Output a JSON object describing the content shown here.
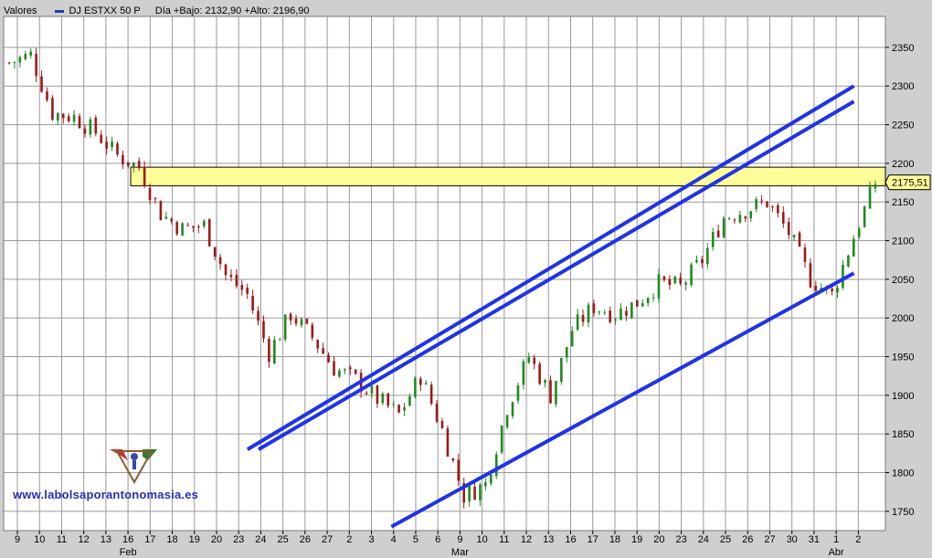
{
  "header": {
    "panel_label": "Valores",
    "series_label": "DJ ESTXX 50 P",
    "stats": "Día +Bajo: 2132,90 +Alto: 2196,90"
  },
  "price_label": "2175,51",
  "watermark": {
    "text": "www.labolsaporantonomasia.es"
  },
  "colors": {
    "background": "#ffffff",
    "panel": "#cfcfcf",
    "grid": "#9a9a9a",
    "up_candle": "#1e8a1e",
    "down_candle": "#a01818",
    "channel": "#1f33e8",
    "zone_fill": "#ffff99",
    "zone_stroke": "#000000"
  },
  "chart_data": {
    "type": "candlestick",
    "ylim": [
      1725,
      2390
    ],
    "y_ticks": [
      1750,
      1800,
      1850,
      1900,
      1950,
      2000,
      2050,
      2100,
      2150,
      2200,
      2250,
      2300,
      2350
    ],
    "x_ticks": [
      "9",
      "10",
      "11",
      "12",
      "13",
      "16",
      "17",
      "18",
      "19",
      "20",
      "23",
      "24",
      "25",
      "26",
      "27",
      "2",
      "3",
      "4",
      "5",
      "6",
      "9",
      "10",
      "11",
      "12",
      "13",
      "16",
      "17",
      "18",
      "19",
      "20",
      "23",
      "24",
      "25",
      "26",
      "27",
      "30",
      "31",
      "1",
      "2"
    ],
    "month_labels": [
      {
        "label": "Feb",
        "at_tick": 5
      },
      {
        "label": "Mar",
        "at_tick": 20
      },
      {
        "label": "Abr",
        "at_tick": 37
      }
    ],
    "daily_closes": [
      2330,
      2340,
      2265,
      2260,
      2240,
      2210,
      2195,
      2135,
      2115,
      2120,
      2055,
      2030,
      1955,
      2005,
      1975,
      1935,
      1920,
      1895,
      1875,
      1925,
      1855,
      1770,
      1785,
      1885,
      1950,
      1900,
      1985,
      2015,
      2005,
      2020,
      2045,
      2040,
      2075,
      2130,
      2140,
      2150,
      2110,
      2050,
      2030,
      2105,
      2175
    ],
    "resistance_zone": [
      2171,
      2195
    ],
    "last_price": 2175.51,
    "channel_lines": [
      {
        "from": {
          "tick": 10.4,
          "value": 1830
        },
        "to": {
          "tick": 37.8,
          "value": 2300
        }
      },
      {
        "from": {
          "tick": 10.9,
          "value": 1830
        },
        "to": {
          "tick": 37.8,
          "value": 2280
        }
      },
      {
        "from": {
          "tick": 16.9,
          "value": 1730
        },
        "to": {
          "tick": 37.8,
          "value": 2058
        }
      }
    ]
  }
}
